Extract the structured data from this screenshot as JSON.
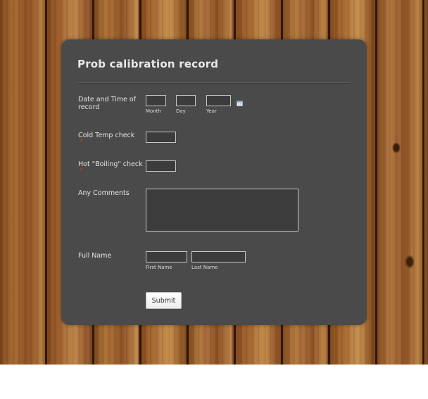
{
  "form": {
    "title": "Prob calibration record",
    "date_time": {
      "label": "Date and Time of record",
      "month_label": "Month",
      "day_label": "Day",
      "year_label": "Year",
      "month_value": "",
      "day_value": "",
      "year_value": "",
      "icon": "calendar-icon"
    },
    "cold_temp": {
      "label": "Cold Temp check",
      "required_mark": "*",
      "value": ""
    },
    "hot_temp": {
      "label": "Hot \"Boiling\" check",
      "required_mark": "*",
      "value": ""
    },
    "comments": {
      "label": "Any Comments",
      "value": ""
    },
    "full_name": {
      "label": "Full Name",
      "first_label": "First Name",
      "last_label": "Last Name",
      "first_value": "",
      "last_value": ""
    },
    "submit_label": "Submit"
  },
  "colors": {
    "card_background": "#4a4a4a",
    "field_border": "#c7c7c7",
    "required": "#d23a2a"
  }
}
